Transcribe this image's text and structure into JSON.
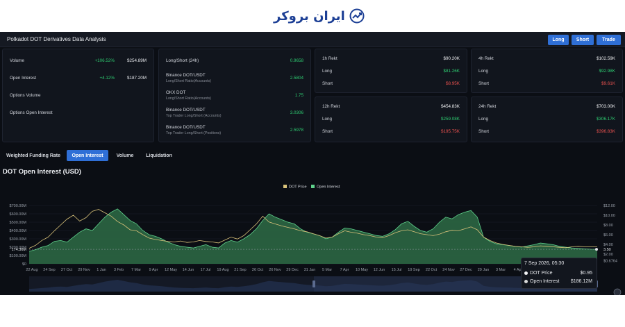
{
  "brand": {
    "logo_text": "ایران بروکر",
    "logo_color": "#1c3f95"
  },
  "header": {
    "title": "Polkadot DOT Derivatives Data Analysis",
    "buttons": {
      "long": "Long",
      "short": "Short",
      "trade": "Trade"
    }
  },
  "summary": {
    "volume": {
      "label": "Volume",
      "change": "+106.52%",
      "value": "$254.89M"
    },
    "open_interest": {
      "label": "Open Interest",
      "change": "+4.12%",
      "value": "$187.20M"
    },
    "options_volume": {
      "label": "Options Volume"
    },
    "options_open_interest": {
      "label": "Options Open Interest"
    }
  },
  "ratios": {
    "ls24": {
      "label": "Long/Short (24h)",
      "value": "0.9658"
    },
    "binance_accounts": {
      "label": "Binance DOT/USDT",
      "sub": "Long/Short Ratio(Accounts)",
      "value": "2.5804"
    },
    "okx": {
      "label": "OKX DOT",
      "sub": "Long/Short Ratio(Accounts)",
      "value": "1.75"
    },
    "binance_top_accounts": {
      "label": "Binance DOT/USDT",
      "sub": "Top Trader Long/Short (Accounts)",
      "value": "3.0306"
    },
    "binance_top_positions": {
      "label": "Binance DOT/USDT",
      "sub": "Top Trader Long/Short (Positions)",
      "value": "2.5978"
    }
  },
  "rekt": {
    "h1": {
      "title": "1h Rekt",
      "total": "$90.20K",
      "long_label": "Long",
      "long": "$81.26K",
      "short_label": "Short",
      "short": "$8.95K"
    },
    "h4": {
      "title": "4h Rekt",
      "total": "$102.59K",
      "long_label": "Long",
      "long": "$92.98K",
      "short_label": "Short",
      "short": "$9.61K"
    },
    "h12": {
      "title": "12h Rekt",
      "total": "$454.83K",
      "long_label": "Long",
      "long": "$259.08K",
      "short_label": "Short",
      "short": "$195.75K"
    },
    "h24": {
      "title": "24h Rekt",
      "total": "$703.00K",
      "long_label": "Long",
      "long": "$306.17K",
      "short_label": "Short",
      "short": "$396.83K"
    }
  },
  "tabs": [
    "Weighted Funding Rate",
    "Open Interest",
    "Volume",
    "Liquidation"
  ],
  "active_tab": "Open Interest",
  "chart_title": "DOT Open Interest (USD)",
  "colors": {
    "price": "#d9c27a",
    "oi_fill": "#2e6b45",
    "oi_line": "#5fd18c",
    "accent": "#2f6fd6"
  },
  "tooltip": {
    "date": "7 Sep 2026, 05:30",
    "price_label": "DOT Price",
    "price_value": "$0.95",
    "oi_label": "Open Interest",
    "oi_value": "$186.12M"
  },
  "chart_data": {
    "type": "area",
    "title": "DOT Open Interest (USD)",
    "legend": [
      "DOT Price",
      "Open Interest"
    ],
    "legend_position": "top-center",
    "x_ticks": [
      "22 Aug",
      "24 Sep",
      "27 Oct",
      "29 Nov",
      "1 Jan",
      "3 Feb",
      "7 Mar",
      "9 Apr",
      "12 May",
      "14 Jun",
      "17 Jul",
      "19 Aug",
      "21 Sep",
      "26 Oct",
      "26 Nov",
      "29 Dec",
      "31 Jan",
      "5 Mar",
      "7 Apr",
      "10 May",
      "12 Jun",
      "15 Jul",
      "19 Sep",
      "22 Oct",
      "24 Nov",
      "27 Dec",
      "29 Jan",
      "3 Mar",
      "4 Apr"
    ],
    "y_left_ticks": [
      "$0",
      "$100.00M",
      "$200.00M",
      "$300.00M",
      "$400.00M",
      "$500.00M",
      "$600.00M",
      "$700.00M"
    ],
    "y_right_ticks": [
      "$0.6764",
      "$2.00",
      "$4.00",
      "$6.00",
      "$8.00",
      "$10.00",
      "$12.00"
    ],
    "y_left_range": [
      0,
      700000000
    ],
    "y_right_range": [
      0,
      12
    ],
    "current_oi_label": "174.36M",
    "current_price_label": "3.50",
    "series": [
      {
        "name": "Open Interest",
        "axis": "left",
        "values": [
          150,
          170,
          200,
          220,
          270,
          280,
          260,
          320,
          380,
          420,
          400,
          480,
          560,
          620,
          660,
          590,
          520,
          480,
          400,
          350,
          330,
          300,
          260,
          230,
          210,
          200,
          190,
          210,
          230,
          200,
          190,
          250,
          280,
          260,
          300,
          350,
          420,
          520,
          600,
          560,
          530,
          500,
          480,
          420,
          380,
          360,
          340,
          300,
          320,
          380,
          430,
          420,
          400,
          380,
          360,
          340,
          330,
          360,
          410,
          480,
          510,
          450,
          400,
          380,
          420,
          500,
          560,
          540,
          590,
          620,
          640,
          560,
          320,
          270,
          240,
          230,
          220,
          210,
          200,
          215,
          230,
          250,
          240,
          230,
          210,
          200,
          190,
          185,
          180,
          176,
          174
        ]
      },
      {
        "name": "DOT Price",
        "axis": "right",
        "values": [
          3.2,
          3.8,
          4.8,
          5.5,
          6.8,
          8.0,
          9.2,
          10.0,
          8.8,
          9.5,
          10.8,
          11.2,
          10.5,
          9.8,
          8.7,
          8.0,
          7.0,
          6.8,
          6.0,
          5.3,
          5.0,
          4.8,
          4.6,
          4.5,
          4.7,
          4.4,
          4.5,
          4.8,
          4.6,
          4.5,
          4.3,
          4.9,
          5.5,
          5.1,
          5.8,
          7.0,
          8.2,
          9.8,
          8.6,
          8.2,
          7.8,
          7.5,
          7.2,
          6.8,
          6.6,
          6.2,
          5.8,
          5.3,
          5.5,
          6.2,
          6.8,
          6.5,
          6.3,
          6.0,
          5.8,
          5.5,
          5.4,
          5.8,
          6.4,
          6.8,
          7.0,
          6.6,
          6.2,
          6.0,
          5.8,
          6.1,
          6.6,
          6.9,
          6.8,
          7.2,
          7.6,
          7.0,
          5.5,
          4.8,
          4.3,
          4.0,
          3.8,
          3.6,
          3.5,
          3.4,
          3.5,
          3.7,
          3.6,
          3.5,
          3.4,
          3.3,
          3.5,
          3.6,
          3.5,
          3.5,
          3.5
        ]
      }
    ],
    "tooltip_point": {
      "date": "7 Sep 2026, 05:30",
      "price": 0.95,
      "open_interest": 186120000
    }
  }
}
